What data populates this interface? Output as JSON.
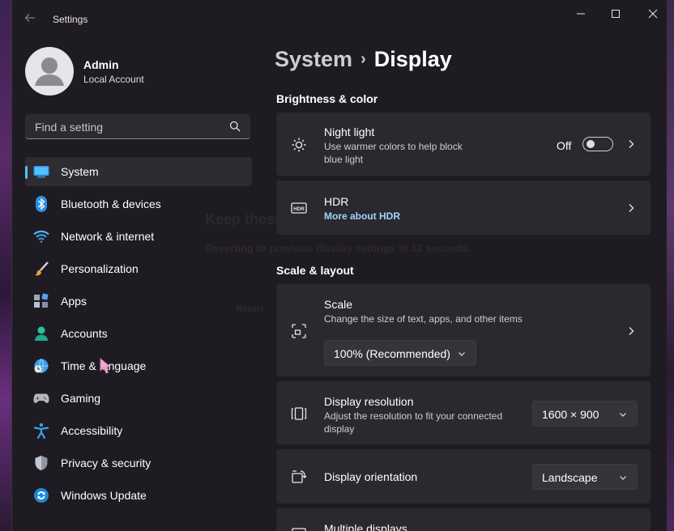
{
  "window": {
    "title": "Settings"
  },
  "profile": {
    "name": "Admin",
    "account_type": "Local Account"
  },
  "search": {
    "placeholder": "Find a setting"
  },
  "sidebar": {
    "items": [
      {
        "label": "System",
        "icon": "monitor-icon",
        "active": true
      },
      {
        "label": "Bluetooth & devices",
        "icon": "bluetooth-icon"
      },
      {
        "label": "Network & internet",
        "icon": "wifi-icon"
      },
      {
        "label": "Personalization",
        "icon": "paintbrush-icon"
      },
      {
        "label": "Apps",
        "icon": "apps-icon"
      },
      {
        "label": "Accounts",
        "icon": "person-icon"
      },
      {
        "label": "Time & language",
        "icon": "globe-clock-icon"
      },
      {
        "label": "Gaming",
        "icon": "gamepad-icon"
      },
      {
        "label": "Accessibility",
        "icon": "accessibility-icon"
      },
      {
        "label": "Privacy & security",
        "icon": "shield-icon"
      },
      {
        "label": "Windows Update",
        "icon": "update-icon"
      }
    ]
  },
  "breadcrumb": {
    "parent": "System",
    "separator": "›",
    "current": "Display"
  },
  "brightness_section": {
    "title": "Brightness & color",
    "night_light": {
      "title": "Night light",
      "description_line1": "Use warmer colors to help block",
      "description_line2": "blue light",
      "state_label": "Off"
    },
    "hdr": {
      "title": "HDR",
      "link": "More about HDR"
    }
  },
  "scale_section": {
    "title": "Scale & layout",
    "scale": {
      "title": "Scale",
      "description": "Change the size of text, apps, and other items",
      "value": "100% (Recommended)"
    },
    "resolution": {
      "title": "Display resolution",
      "description_line1": "Adjust the resolution to fit your connected",
      "description_line2": "display",
      "value": "1600 × 900"
    },
    "orientation": {
      "title": "Display orientation",
      "value": "Landscape"
    },
    "multiple_displays": {
      "title": "Multiple displays"
    }
  },
  "ghost_dialog": {
    "title": "Keep these display settings?",
    "message": "Reverting to previous display settings in 12 seconds.",
    "action": "Revert"
  },
  "colors": {
    "accent": "#4cc2ff",
    "window_bg": "#1f1b22",
    "card_bg": "#2b2830",
    "link": "#9fd6ff"
  }
}
